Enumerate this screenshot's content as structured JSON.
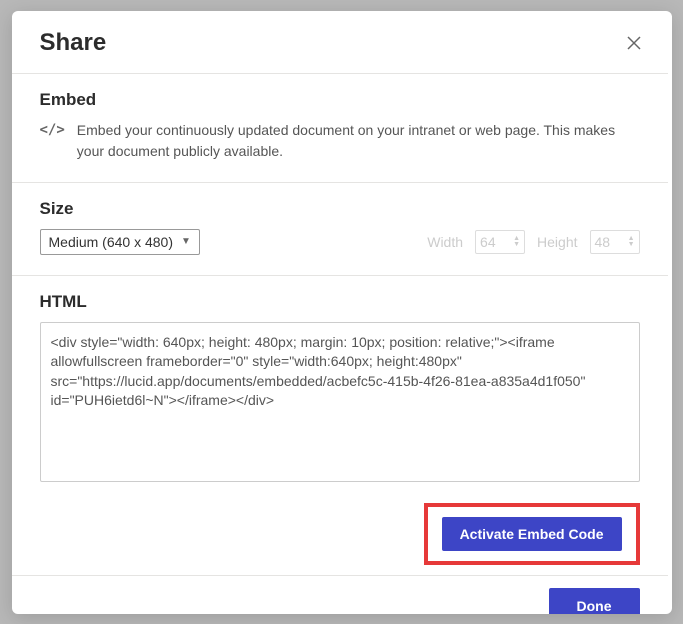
{
  "header": {
    "title": "Share"
  },
  "embed": {
    "title": "Embed",
    "icon_label": "</>",
    "description": "Embed your continuously updated document on your intranet or web page. This makes your document publicly available."
  },
  "size": {
    "title": "Size",
    "selected": "Medium (640 x 480)",
    "width_label": "Width",
    "width_value": "64",
    "height_label": "Height",
    "height_value": "48"
  },
  "html": {
    "title": "HTML",
    "code": "<div style=\"width: 640px; height: 480px; margin: 10px; position: relative;\"><iframe allowfullscreen frameborder=\"0\" style=\"width:640px; height:480px\" src=\"https://lucid.app/documents/embedded/acbefc5c-415b-4f26-81ea-a835a4d1f050\" id=\"PUH6ietd6l~N\"></iframe></div>",
    "activate_label": "Activate Embed Code"
  },
  "footer": {
    "done_label": "Done"
  }
}
